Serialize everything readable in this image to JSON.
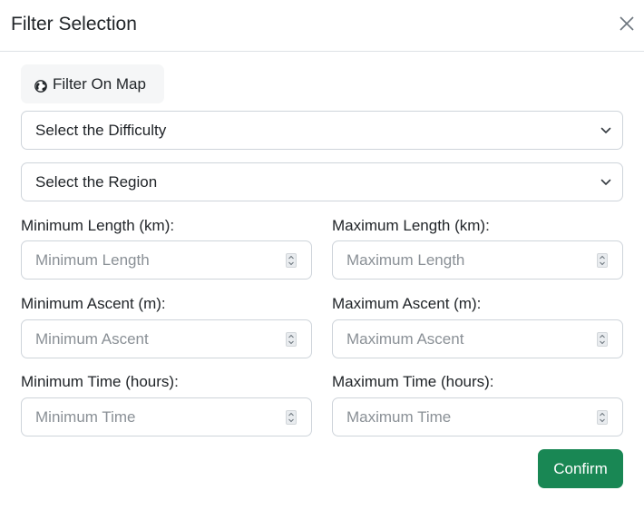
{
  "modal": {
    "title": "Filter Selection"
  },
  "map_button": {
    "label": "Filter On Map",
    "icon": "globe-icon"
  },
  "selects": {
    "difficulty": "Select the Difficulty",
    "region": "Select the Region"
  },
  "fields": {
    "min_length": {
      "label": "Minimum Length (km):",
      "placeholder": "Minimum Length"
    },
    "max_length": {
      "label": "Maximum Length (km):",
      "placeholder": "Maximum Length"
    },
    "min_ascent": {
      "label": "Minimum Ascent (m):",
      "placeholder": "Minimum Ascent"
    },
    "max_ascent": {
      "label": "Maximum Ascent (m):",
      "placeholder": "Maximum Ascent"
    },
    "min_time": {
      "label": "Minimum Time (hours):",
      "placeholder": "Minimum Time"
    },
    "max_time": {
      "label": "Maximum Time (hours):",
      "placeholder": "Maximum Time"
    }
  },
  "confirm_button": {
    "label": "Confirm"
  },
  "colors": {
    "confirm_bg": "#198754",
    "border": "#ced4da",
    "map_button_bg": "#f5f6f7"
  }
}
